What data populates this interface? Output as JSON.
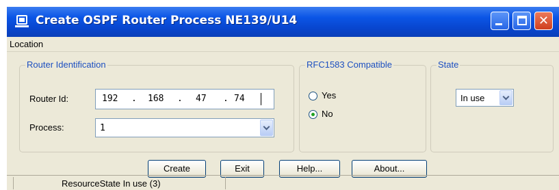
{
  "window": {
    "title": "Create OSPF Router Process  NE139/U14",
    "close_symbol": "✕"
  },
  "menu": {
    "location": "Location"
  },
  "router_identification": {
    "legend": "Router Identification",
    "router_id_label": "Router Id:",
    "router_id": {
      "oct1": "192",
      "oct2": "168",
      "oct3": "47",
      "oct4": "74",
      "sep": "."
    },
    "process_label": "Process:",
    "process_value": "1"
  },
  "rfc1583": {
    "legend": "RFC1583 Compatible",
    "yes_label": "Yes",
    "no_label": "No",
    "selected": "No"
  },
  "state": {
    "legend": "State",
    "value": "In use"
  },
  "buttons": {
    "create": "Create",
    "exit": "Exit",
    "help": "Help...",
    "about": "About..."
  },
  "status_bar": {
    "text": "ResourceState In use (3)"
  },
  "colors": {
    "titlebar_blue": "#0b55e6",
    "legend_blue": "#1c4fc0",
    "dialog_bg": "#ece9d8",
    "radio_dot_green": "#21a121",
    "close_red": "#cf3e1e"
  }
}
